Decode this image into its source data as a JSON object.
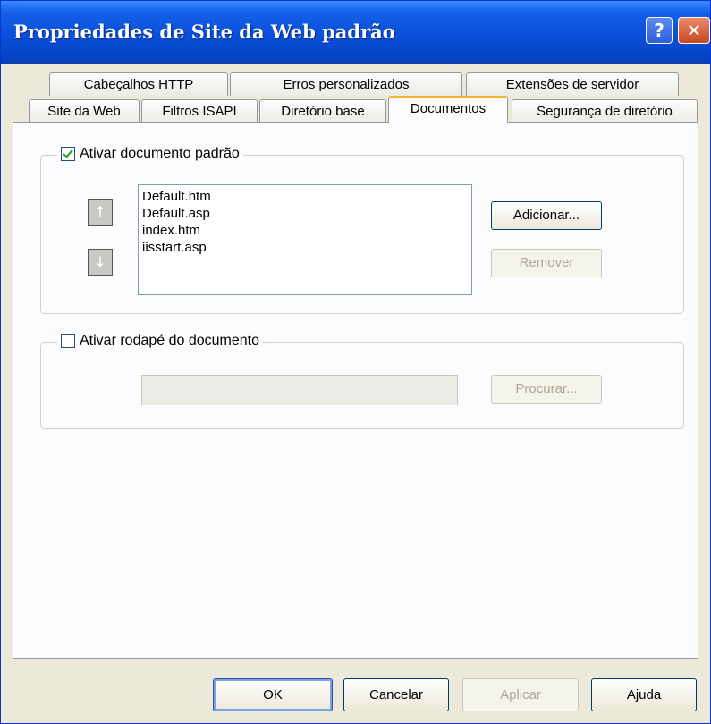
{
  "window": {
    "title": "Propriedades de Site da Web padrão",
    "help_glyph": "?",
    "close_glyph": "✕"
  },
  "tabs": {
    "row_top": [
      "Cabeçalhos HTTP",
      "Erros personalizados",
      "Extensões de servidor"
    ],
    "row_bottom": [
      "Site da Web",
      "Filtros ISAPI",
      "Diretório base",
      "Documentos",
      "Segurança de diretório"
    ],
    "active": "Documentos"
  },
  "default_document": {
    "checkbox_label": "Ativar documento padrão",
    "checked": true,
    "documents": [
      "Default.htm",
      "Default.asp",
      "index.htm",
      "iisstart.asp"
    ],
    "move_up_glyph": "↑",
    "move_down_glyph": "↓",
    "add_label": "Adicionar...",
    "remove_label": "Remover"
  },
  "footer": {
    "checkbox_label": "Ativar rodapé do documento",
    "checked": false,
    "path_value": "",
    "browse_label": "Procurar..."
  },
  "buttons": {
    "ok": "OK",
    "cancel": "Cancelar",
    "apply": "Aplicar",
    "help": "Ajuda"
  }
}
